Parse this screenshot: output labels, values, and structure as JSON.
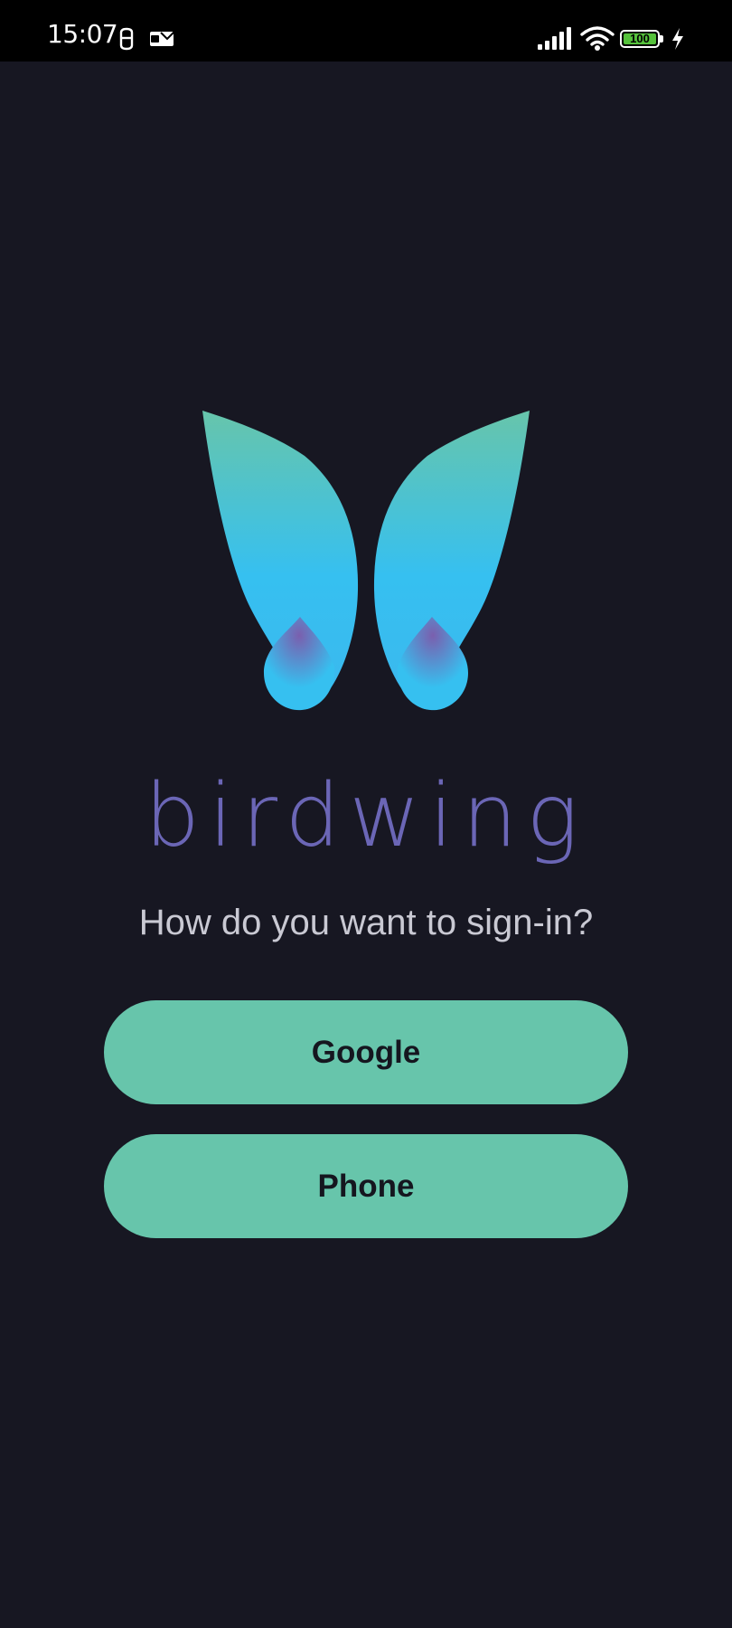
{
  "status_bar": {
    "time": "15:07",
    "battery_level": "100",
    "icons": [
      "notification-icon",
      "mail-icon",
      "signal-icon",
      "wifi-icon",
      "battery-icon",
      "charging-icon"
    ]
  },
  "app": {
    "logo_icon": "birdwing-logo-icon",
    "wordmark": "birdwing"
  },
  "signin": {
    "prompt": "How do you want to sign-in?",
    "google_label": "Google",
    "phone_label": "Phone"
  },
  "colors": {
    "background": "#171722",
    "button": "#67c5ab",
    "button_text": "#15161f",
    "wordmark": "#6b66b6",
    "prompt_text": "#c9c9d3",
    "logo_top": "#67c5ab",
    "logo_mid": "#36c0f0",
    "logo_accent": "#7a5fae"
  }
}
